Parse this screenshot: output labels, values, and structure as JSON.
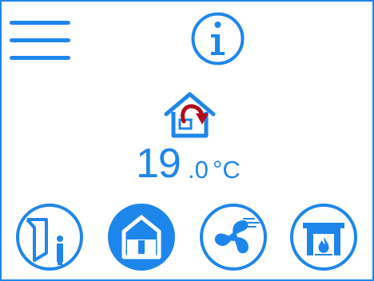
{
  "header": {
    "menu_icon": "hamburger-menu-icon",
    "info_icon": "info-icon"
  },
  "status": {
    "mode_icon": "house-boost-icon",
    "temperature_whole": "19",
    "temperature_decimal": ".0",
    "temperature_unit": "°C"
  },
  "modes": [
    {
      "icon": "away-mode-icon",
      "selected": false
    },
    {
      "icon": "home-mode-icon",
      "selected": true
    },
    {
      "icon": "fan-mode-icon",
      "selected": false
    },
    {
      "icon": "fireplace-mode-icon",
      "selected": false
    }
  ],
  "colors": {
    "accent": "#1e86ea",
    "alert": "#b00d1d",
    "background": "#ffffff"
  }
}
